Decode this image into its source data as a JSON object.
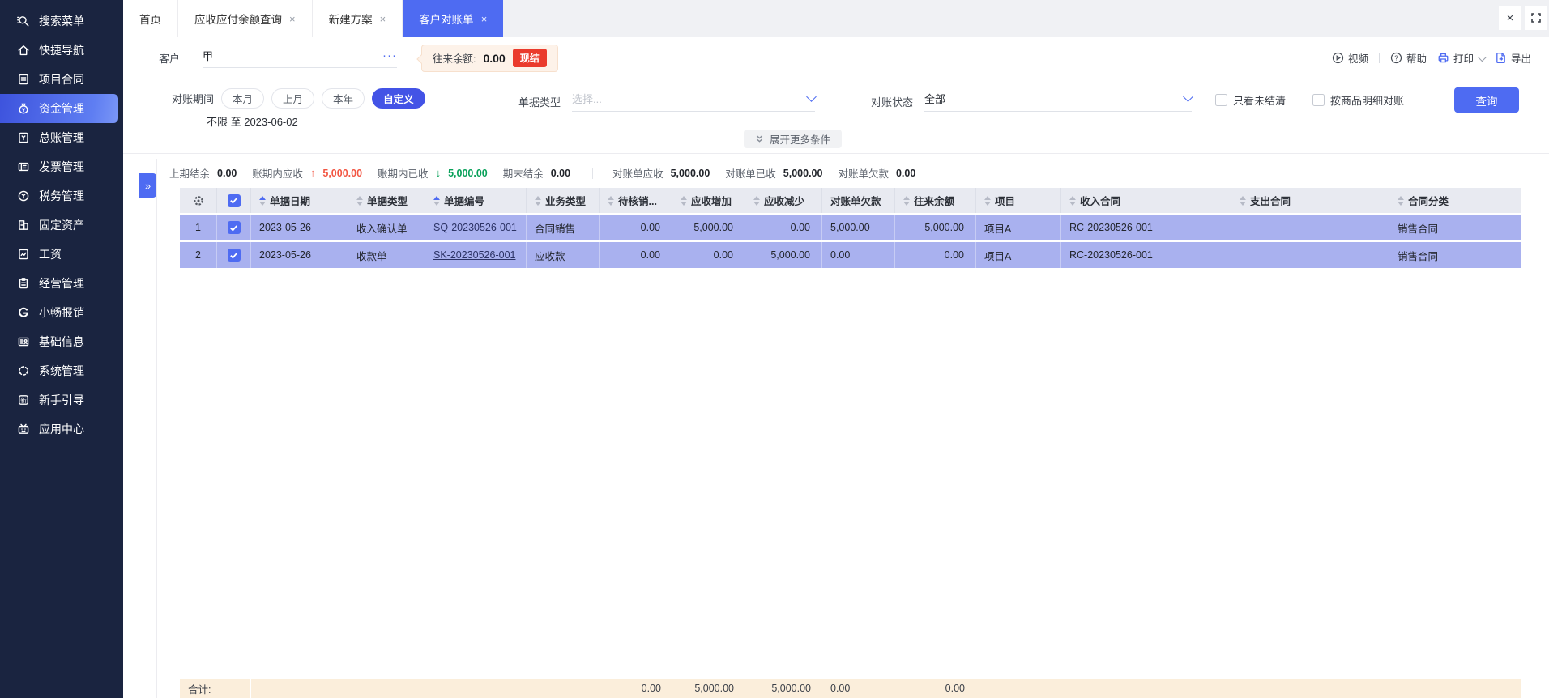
{
  "appearance": {
    "accent_blue": "#4e6bf2",
    "sidebar_bg": "#1a2440",
    "selected_row_bg": "#a9b1ef",
    "footer_bg": "#fbeedb",
    "badge_red": "#ea3b2d",
    "increase_red": "#f25643",
    "decrease_green": "#09a15a"
  },
  "sidebar": {
    "items": [
      {
        "icon": "search-icon",
        "label": "搜索菜单"
      },
      {
        "icon": "home-icon",
        "label": "快捷导航"
      },
      {
        "icon": "project-contract-icon",
        "label": "项目合同"
      },
      {
        "icon": "funds-icon",
        "label": "资金管理",
        "active": true
      },
      {
        "icon": "ledger-icon",
        "label": "总账管理"
      },
      {
        "icon": "invoice-icon",
        "label": "发票管理"
      },
      {
        "icon": "tax-icon",
        "label": "税务管理"
      },
      {
        "icon": "fixed-assets-icon",
        "label": "固定资产"
      },
      {
        "icon": "salary-icon",
        "label": "工资"
      },
      {
        "icon": "business-icon",
        "label": "经营管理"
      },
      {
        "icon": "expense-icon",
        "label": "小畅报销"
      },
      {
        "icon": "base-info-icon",
        "label": "基础信息"
      },
      {
        "icon": "system-icon",
        "label": "系统管理"
      },
      {
        "icon": "guide-icon",
        "label": "新手引导"
      },
      {
        "icon": "app-center-icon",
        "label": "应用中心"
      }
    ]
  },
  "tabs": {
    "items": [
      {
        "label": "首页",
        "closable": false,
        "active": false
      },
      {
        "label": "应收应付余额查询",
        "closable": true,
        "active": false
      },
      {
        "label": "新建方案",
        "closable": true,
        "active": false
      },
      {
        "label": "客户对账单",
        "closable": true,
        "active": true
      }
    ],
    "close_glyph": "×"
  },
  "header": {
    "customer_label": "客户",
    "customer_value": "甲",
    "ellipsis": "···",
    "balance_label": "往来余额:",
    "balance_value": "0.00",
    "badge": "现结",
    "actions": {
      "video": "视频",
      "help": "帮助",
      "print": "打印",
      "export": "导出"
    }
  },
  "filters": {
    "period_label": "对账期间",
    "period_options": {
      "0": "本月",
      "1": "上月",
      "2": "本年",
      "3": "自定义"
    },
    "period_active": "自定义",
    "period_range": "不限 至 2023-06-02",
    "doc_type_label": "单据类型",
    "doc_type_placeholder": "选择...",
    "status_label": "对账状态",
    "status_value": "全部",
    "checkbox_unsettled": "只看未结清",
    "checkbox_by_product": "按商品明细对账",
    "query_button": "查询",
    "expand_more": "展开更多条件"
  },
  "summary": {
    "prev_balance_label": "上期结余",
    "prev_balance_value": "0.00",
    "period_receivable_label": "账期内应收",
    "period_receivable_value": "5,000.00",
    "period_received_label": "账期内已收",
    "period_received_value": "5,000.00",
    "end_balance_label": "期末结余",
    "end_balance_value": "0.00",
    "stmt_receivable_label": "对账单应收",
    "stmt_receivable_value": "5,000.00",
    "stmt_received_label": "对账单已收",
    "stmt_received_value": "5,000.00",
    "stmt_debt_label": "对账单欠款",
    "stmt_debt_value": "0.00"
  },
  "table": {
    "columns": {
      "2": {
        "label": "单据日期",
        "sort": "asc"
      },
      "3": {
        "label": "单据类型",
        "sort": "none"
      },
      "4": {
        "label": "单据编号",
        "sort": "asc"
      },
      "5": {
        "label": "业务类型",
        "sort": "none"
      },
      "6": {
        "label": "待核销...",
        "sort": "none"
      },
      "7": {
        "label": "应收增加",
        "sort": "none"
      },
      "8": {
        "label": "应收减少",
        "sort": "none"
      },
      "9": {
        "label": "对账单欠款",
        "sort": null
      },
      "10": {
        "label": "往来余额",
        "sort": "none"
      },
      "11": {
        "label": "项目",
        "sort": "none"
      },
      "12": {
        "label": "收入合同",
        "sort": "none"
      },
      "13": {
        "label": "支出合同",
        "sort": "none"
      },
      "14": {
        "label": "合同分类",
        "sort": "none"
      }
    },
    "rows": {
      "0": {
        "index": "1",
        "checked": true,
        "date": "2023-05-26",
        "doc_type": "收入确认单",
        "doc_no": "SQ-20230526-001",
        "biz_type": "合同销售",
        "pending": "0.00",
        "ar_increase": "5,000.00",
        "ar_decrease": "0.00",
        "stmt_debt": "5,000.00",
        "balance": "5,000.00",
        "project": "项目A",
        "income_contract": "RC-20230526-001",
        "expense_contract": "",
        "contract_category": "销售合同"
      },
      "1": {
        "index": "2",
        "checked": true,
        "date": "2023-05-26",
        "doc_type": "收款单",
        "doc_no": "SK-20230526-001",
        "biz_type": "应收款",
        "pending": "0.00",
        "ar_increase": "0.00",
        "ar_decrease": "5,000.00",
        "stmt_debt": "0.00",
        "balance": "0.00",
        "project": "项目A",
        "income_contract": "RC-20230526-001",
        "expense_contract": "",
        "contract_category": "销售合同"
      }
    },
    "footer": {
      "label": "合计:",
      "pending": "0.00",
      "ar_increase": "5,000.00",
      "ar_decrease": "5,000.00",
      "stmt_debt": "0.00",
      "balance": "0.00"
    }
  },
  "window_controls": {
    "close": "×",
    "fullscreen": "⛶"
  },
  "panel_expand_glyph": "»"
}
